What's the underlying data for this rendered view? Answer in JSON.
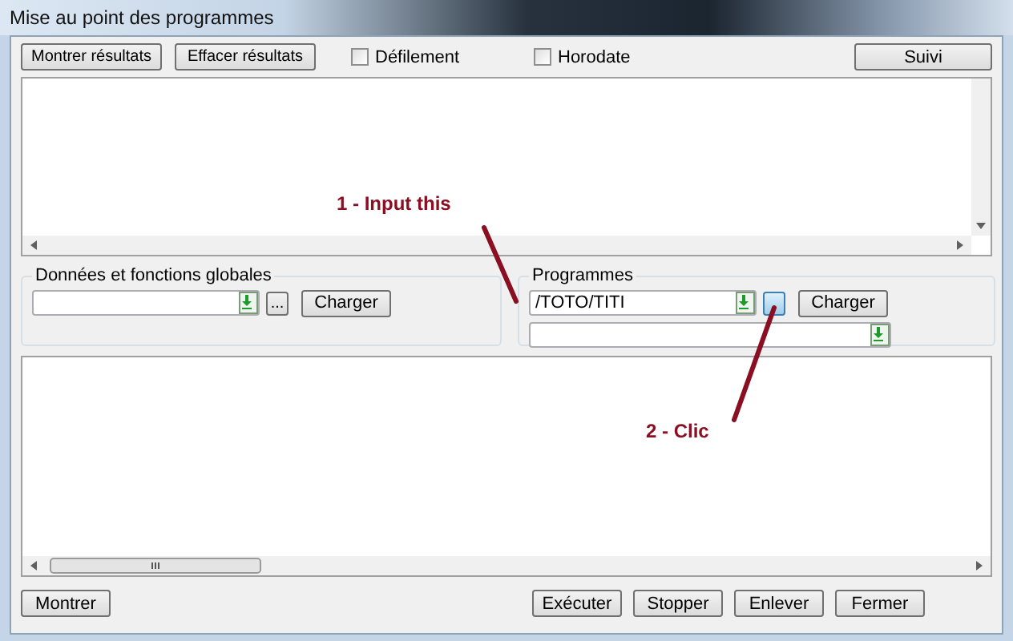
{
  "window": {
    "title": "Mise au point des programmes"
  },
  "toolbar": {
    "buttons": [
      "Montrer résultats",
      "Effacer résultats"
    ],
    "checkboxes": [
      {
        "label": "Défilement",
        "checked": false
      },
      {
        "label": "Horodate",
        "checked": false
      }
    ],
    "right_button": "Suivi"
  },
  "groups": [
    {
      "title": "Données et fonctions globales",
      "rows": [
        {
          "kind": "combo",
          "browse": {
            "label": "...",
            "highlighted": false
          },
          "load_button": "Charger"
        }
      ]
    },
    {
      "title": "Programmes",
      "rows": [
        {
          "kind": "combo",
          "value": "/TOTO/TITI",
          "browse": {
            "highlighted": true
          },
          "load_button": "Charger"
        },
        {
          "kind": "combo"
        }
      ]
    }
  ],
  "footer": {
    "left_button": "Montrer",
    "buttons": [
      "Exécuter",
      "Stopper",
      "Enlever",
      "Fermer"
    ]
  },
  "annotations": [
    {
      "text": "1 - Input this"
    },
    {
      "text": "2 - Clic"
    }
  ]
}
